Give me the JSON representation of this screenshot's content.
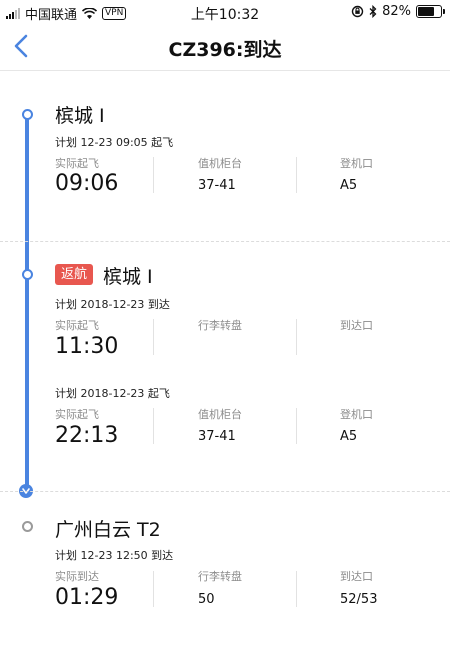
{
  "status_bar": {
    "carrier": "中国联通",
    "vpn": "VPN",
    "time": "上午10:32",
    "battery": "82%",
    "battery_level": 0.82
  },
  "nav": {
    "title": "CZ396:到达"
  },
  "legs": [
    {
      "city": "槟城 I",
      "plan": "计划 12-23 09:05 起飞",
      "cols": [
        {
          "label": "实际起飞",
          "value": "09:06"
        },
        {
          "label": "值机柜台",
          "value": "37-41"
        },
        {
          "label": "登机口",
          "value": "A5"
        }
      ]
    },
    {
      "badge": "返航",
      "city": "槟城 I",
      "arrival": {
        "plan": "计划 2018-12-23 到达",
        "cols": [
          {
            "label": "实际起飞",
            "value": "11:30"
          },
          {
            "label": "行李转盘",
            "value": ""
          },
          {
            "label": "到达口",
            "value": ""
          }
        ]
      },
      "departure": {
        "plan": "计划 2018-12-23 起飞",
        "cols": [
          {
            "label": "实际起飞",
            "value": "22:13"
          },
          {
            "label": "值机柜台",
            "value": "37-41"
          },
          {
            "label": "登机口",
            "value": "A5"
          }
        ]
      }
    },
    {
      "city": "广州白云 T2",
      "plan": "计划 12-23 12:50 到达",
      "cols": [
        {
          "label": "实际到达",
          "value": "01:29"
        },
        {
          "label": "行李转盘",
          "value": "50"
        },
        {
          "label": "到达口",
          "value": "52/53"
        }
      ]
    }
  ],
  "colors": {
    "accent": "#4a84e0",
    "badge": "#e8574f"
  }
}
